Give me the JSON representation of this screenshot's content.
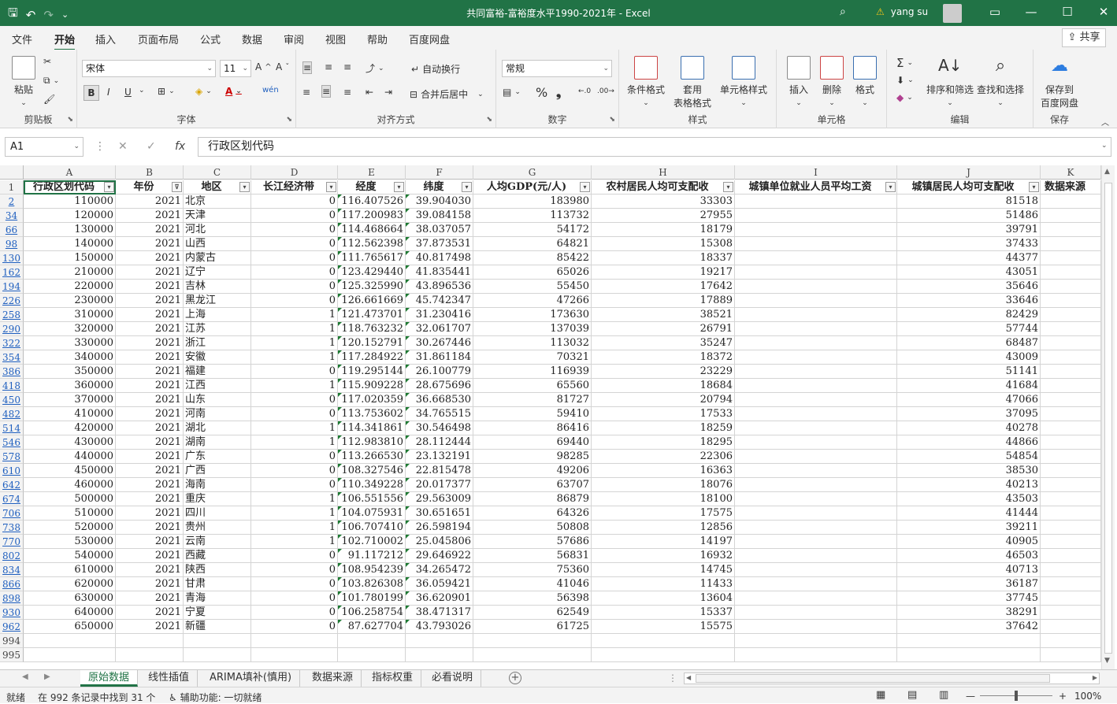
{
  "window": {
    "title": "共同富裕-富裕度水平1990-2021年  -  Excel",
    "user": "yang su",
    "warning_icon": "warning-icon",
    "share_label": "共享"
  },
  "menu": [
    "文件",
    "开始",
    "插入",
    "页面布局",
    "公式",
    "数据",
    "审阅",
    "视图",
    "帮助",
    "百度网盘"
  ],
  "ribbon": {
    "clipboard": {
      "paste": "粘贴",
      "label": "剪贴板"
    },
    "font": {
      "name": "宋体",
      "size": "11",
      "bold": "B",
      "italic": "I",
      "underline": "U",
      "phonetic": "wén",
      "label": "字体"
    },
    "align": {
      "wrap": "自动换行",
      "merge": "合并后居中",
      "label": "对齐方式"
    },
    "number": {
      "format": "常规",
      "percent": "%",
      "comma": "❟",
      "label": "数字"
    },
    "styles": {
      "cond": "条件格式",
      "table1": "套用",
      "table2": "表格格式",
      "cell": "单元格样式",
      "label": "样式"
    },
    "cells": {
      "insert": "插入",
      "delete": "删除",
      "format": "格式",
      "label": "单元格"
    },
    "edit": {
      "sort": "排序和筛选",
      "find": "查找和选择",
      "label": "编辑"
    },
    "save": {
      "l1": "保存到",
      "l2": "百度网盘",
      "label": "保存"
    }
  },
  "formula_bar": {
    "name_box": "A1",
    "fx": "fx",
    "value": "行政区划代码"
  },
  "columns": [
    "A",
    "B",
    "C",
    "D",
    "E",
    "F",
    "G",
    "H",
    "I",
    "J",
    "K"
  ],
  "headers": [
    "行政区划代码",
    "年份",
    "地区",
    "长江经济带",
    "经度",
    "纬度",
    "人均GDP(元/人)",
    "农村居民人均可支配收",
    "城镇单位就业人员平均工资",
    "城镇居民人均可支配收",
    "数据来源"
  ],
  "rows": [
    {
      "n": "2",
      "v": [
        "110000",
        "2021",
        "北京",
        "0",
        "116.407526",
        "39.904030",
        "183980",
        "33303",
        "",
        "81518",
        ""
      ]
    },
    {
      "n": "34",
      "v": [
        "120000",
        "2021",
        "天津",
        "0",
        "117.200983",
        "39.084158",
        "113732",
        "27955",
        "",
        "51486",
        ""
      ]
    },
    {
      "n": "66",
      "v": [
        "130000",
        "2021",
        "河北",
        "0",
        "114.468664",
        "38.037057",
        "54172",
        "18179",
        "",
        "39791",
        ""
      ]
    },
    {
      "n": "98",
      "v": [
        "140000",
        "2021",
        "山西",
        "0",
        "112.562398",
        "37.873531",
        "64821",
        "15308",
        "",
        "37433",
        ""
      ]
    },
    {
      "n": "130",
      "v": [
        "150000",
        "2021",
        "内蒙古",
        "0",
        "111.765617",
        "40.817498",
        "85422",
        "18337",
        "",
        "44377",
        ""
      ]
    },
    {
      "n": "162",
      "v": [
        "210000",
        "2021",
        "辽宁",
        "0",
        "123.429440",
        "41.835441",
        "65026",
        "19217",
        "",
        "43051",
        ""
      ]
    },
    {
      "n": "194",
      "v": [
        "220000",
        "2021",
        "吉林",
        "0",
        "125.325990",
        "43.896536",
        "55450",
        "17642",
        "",
        "35646",
        ""
      ]
    },
    {
      "n": "226",
      "v": [
        "230000",
        "2021",
        "黑龙江",
        "0",
        "126.661669",
        "45.742347",
        "47266",
        "17889",
        "",
        "33646",
        ""
      ]
    },
    {
      "n": "258",
      "v": [
        "310000",
        "2021",
        "上海",
        "1",
        "121.473701",
        "31.230416",
        "173630",
        "38521",
        "",
        "82429",
        ""
      ]
    },
    {
      "n": "290",
      "v": [
        "320000",
        "2021",
        "江苏",
        "1",
        "118.763232",
        "32.061707",
        "137039",
        "26791",
        "",
        "57744",
        ""
      ]
    },
    {
      "n": "322",
      "v": [
        "330000",
        "2021",
        "浙江",
        "1",
        "120.152791",
        "30.267446",
        "113032",
        "35247",
        "",
        "68487",
        ""
      ]
    },
    {
      "n": "354",
      "v": [
        "340000",
        "2021",
        "安徽",
        "1",
        "117.284922",
        "31.861184",
        "70321",
        "18372",
        "",
        "43009",
        ""
      ]
    },
    {
      "n": "386",
      "v": [
        "350000",
        "2021",
        "福建",
        "0",
        "119.295144",
        "26.100779",
        "116939",
        "23229",
        "",
        "51141",
        ""
      ]
    },
    {
      "n": "418",
      "v": [
        "360000",
        "2021",
        "江西",
        "1",
        "115.909228",
        "28.675696",
        "65560",
        "18684",
        "",
        "41684",
        ""
      ]
    },
    {
      "n": "450",
      "v": [
        "370000",
        "2021",
        "山东",
        "0",
        "117.020359",
        "36.668530",
        "81727",
        "20794",
        "",
        "47066",
        ""
      ]
    },
    {
      "n": "482",
      "v": [
        "410000",
        "2021",
        "河南",
        "0",
        "113.753602",
        "34.765515",
        "59410",
        "17533",
        "",
        "37095",
        ""
      ]
    },
    {
      "n": "514",
      "v": [
        "420000",
        "2021",
        "湖北",
        "1",
        "114.341861",
        "30.546498",
        "86416",
        "18259",
        "",
        "40278",
        ""
      ]
    },
    {
      "n": "546",
      "v": [
        "430000",
        "2021",
        "湖南",
        "1",
        "112.983810",
        "28.112444",
        "69440",
        "18295",
        "",
        "44866",
        ""
      ]
    },
    {
      "n": "578",
      "v": [
        "440000",
        "2021",
        "广东",
        "0",
        "113.266530",
        "23.132191",
        "98285",
        "22306",
        "",
        "54854",
        ""
      ]
    },
    {
      "n": "610",
      "v": [
        "450000",
        "2021",
        "广西",
        "0",
        "108.327546",
        "22.815478",
        "49206",
        "16363",
        "",
        "38530",
        ""
      ]
    },
    {
      "n": "642",
      "v": [
        "460000",
        "2021",
        "海南",
        "0",
        "110.349228",
        "20.017377",
        "63707",
        "18076",
        "",
        "40213",
        ""
      ]
    },
    {
      "n": "674",
      "v": [
        "500000",
        "2021",
        "重庆",
        "1",
        "106.551556",
        "29.563009",
        "86879",
        "18100",
        "",
        "43503",
        ""
      ]
    },
    {
      "n": "706",
      "v": [
        "510000",
        "2021",
        "四川",
        "1",
        "104.075931",
        "30.651651",
        "64326",
        "17575",
        "",
        "41444",
        ""
      ]
    },
    {
      "n": "738",
      "v": [
        "520000",
        "2021",
        "贵州",
        "1",
        "106.707410",
        "26.598194",
        "50808",
        "12856",
        "",
        "39211",
        ""
      ]
    },
    {
      "n": "770",
      "v": [
        "530000",
        "2021",
        "云南",
        "1",
        "102.710002",
        "25.045806",
        "57686",
        "14197",
        "",
        "40905",
        ""
      ]
    },
    {
      "n": "802",
      "v": [
        "540000",
        "2021",
        "西藏",
        "0",
        "91.117212",
        "29.646922",
        "56831",
        "16932",
        "",
        "46503",
        ""
      ]
    },
    {
      "n": "834",
      "v": [
        "610000",
        "2021",
        "陕西",
        "0",
        "108.954239",
        "34.265472",
        "75360",
        "14745",
        "",
        "40713",
        ""
      ]
    },
    {
      "n": "866",
      "v": [
        "620000",
        "2021",
        "甘肃",
        "0",
        "103.826308",
        "36.059421",
        "41046",
        "11433",
        "",
        "36187",
        ""
      ]
    },
    {
      "n": "898",
      "v": [
        "630000",
        "2021",
        "青海",
        "0",
        "101.780199",
        "36.620901",
        "56398",
        "13604",
        "",
        "37745",
        ""
      ]
    },
    {
      "n": "930",
      "v": [
        "640000",
        "2021",
        "宁夏",
        "0",
        "106.258754",
        "38.471317",
        "62549",
        "15337",
        "",
        "38291",
        ""
      ]
    },
    {
      "n": "962",
      "v": [
        "650000",
        "2021",
        "新疆",
        "0",
        "87.627704",
        "43.793026",
        "61725",
        "15575",
        "",
        "37642",
        ""
      ]
    },
    {
      "n": "994",
      "v": [
        "",
        "",
        "",
        "",
        "",
        "",
        "",
        "",
        "",
        "",
        ""
      ]
    },
    {
      "n": "995",
      "v": [
        "",
        "",
        "",
        "",
        "",
        "",
        "",
        "",
        "",
        "",
        ""
      ]
    }
  ],
  "sheets": [
    "原始数据",
    "线性插值",
    "ARIMA填补(慎用)",
    "数据来源",
    "指标权重",
    "必看说明"
  ],
  "status": {
    "ready": "就绪",
    "found": "在 992 条记录中找到 31 个",
    "accessibility": "辅助功能: 一切就绪",
    "zoom": "100%"
  }
}
